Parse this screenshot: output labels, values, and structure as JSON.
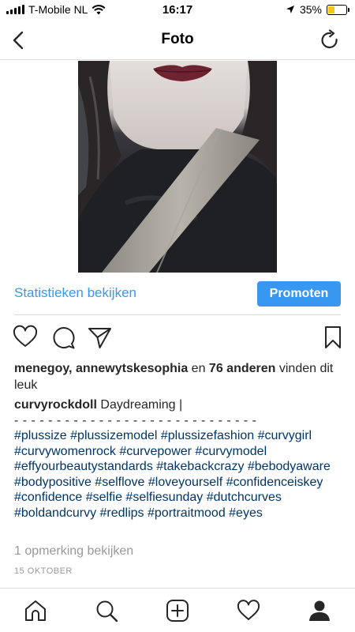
{
  "status_bar": {
    "carrier": "T-Mobile NL",
    "time": "16:17",
    "battery_percent": "35%",
    "battery_level": 0.35,
    "battery_color": "#f5c518"
  },
  "nav": {
    "title": "Foto",
    "back_icon": "chevron-left-icon",
    "refresh_icon": "refresh-icon"
  },
  "actions": {
    "stats_label": "Statistieken bekijken",
    "promote_label": "Promoten",
    "accent_color": "#3897f0"
  },
  "icons": {
    "like": "heart-icon",
    "comment": "comment-bubble-icon",
    "share": "paper-plane-icon",
    "save": "bookmark-icon"
  },
  "likes": {
    "names": "menegoy, annewytskesophia",
    "connector": "en",
    "others": "76 anderen",
    "suffix": "vinden dit leuk"
  },
  "caption": {
    "username": "curvyrockdoll",
    "text": "Daydreaming |",
    "separator": "- - - - - - - - - - - - - - - - - - - - - - - - - - - - -",
    "hashtags": "#plussize #plussizemodel #plussizefashion #curvygirl #curvywomenrock #curvepower #curvymodel #effyourbeautystandards #takebackcrazy #bebodyaware #bodypositive #selflove #loveyourself #confidenceiskey #confidence #selfie #selfiesunday #dutchcurves #boldandcurvy #redlips #portraitmood #eyes",
    "hashtag_color": "#003569"
  },
  "comments_link": "1 opmerking bekijken",
  "date": "15 OKTOBER",
  "tab_bar": [
    "home-icon",
    "search-icon",
    "new-post-icon",
    "activity-heart-icon",
    "profile-icon"
  ]
}
